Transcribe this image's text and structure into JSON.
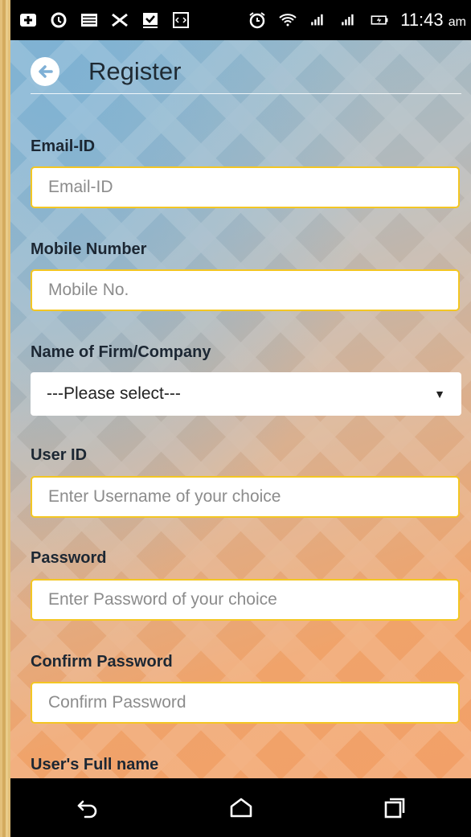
{
  "status_bar": {
    "time": "11:43",
    "ampm": "am",
    "icons": [
      "add-box-icon",
      "sync-icon",
      "image-icon",
      "usb-icon",
      "download-check-icon",
      "code-icon",
      "alarm-icon",
      "wifi-icon",
      "signal-1-icon",
      "signal-2-icon",
      "battery-charging-icon"
    ]
  },
  "header": {
    "title": "Register",
    "back_icon": "back-arrow-icon"
  },
  "form": {
    "email": {
      "label": "Email-ID",
      "placeholder": "Email-ID",
      "value": ""
    },
    "mobile": {
      "label": "Mobile Number",
      "placeholder": "Mobile No.",
      "value": ""
    },
    "company": {
      "label": "Name of Firm/Company",
      "selected": "---Please select---"
    },
    "user_id": {
      "label": "User ID",
      "placeholder": "Enter Username of your choice",
      "value": ""
    },
    "password": {
      "label": "Password",
      "placeholder": "Enter Password of your choice",
      "value": ""
    },
    "confirm_password": {
      "label": "Confirm Password",
      "placeholder": "Confirm Password",
      "value": ""
    },
    "full_name": {
      "label": "User's Full name"
    }
  },
  "nav_bar": {
    "buttons": [
      "back-nav-icon",
      "home-nav-icon",
      "recents-nav-icon"
    ]
  },
  "colors": {
    "field_border": "#f3c623",
    "status_bar": "#000000",
    "title_text": "#1f2a33"
  }
}
